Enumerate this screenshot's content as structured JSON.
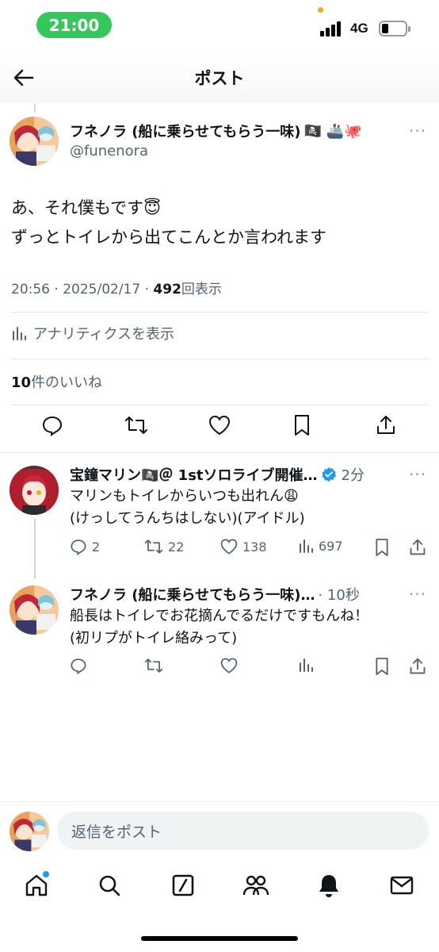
{
  "status": {
    "time": "21:00",
    "network": "4G"
  },
  "header": {
    "title": "ポスト"
  },
  "main_post": {
    "display_name": "フネノラ (船に乗らせてもらう一味)",
    "name_emoji": "🏴‍☠️ 🚢🐙",
    "handle": "@funenora",
    "text_line1": "あ、それ僕もです😇",
    "text_line2": "ずっとトイレから出てこんとか言われます",
    "timestamp": "20:56 · 2025/02/17 · ",
    "views": "492",
    "views_label": "回表示",
    "analytics_label": "アナリティクスを表示",
    "likes_count": "10",
    "likes_label": "件のいいね"
  },
  "replies": [
    {
      "display_name": "宝鐘マリン🏴‍☠️＠ 1stソロライブ開催…",
      "time": "2分",
      "text_line1": "マリンもトイレからいつも出れん😩",
      "text_line2": "(けっしてうんちはしない)(アイドル)",
      "reply_count": "2",
      "retweet_count": "22",
      "like_count": "138",
      "view_count": "697"
    },
    {
      "display_name": "フネノラ (船に乗らせてもらう一味)…",
      "time": "· 10秒",
      "text_line1": "船長はトイレでお花摘んでるだけですもんね！",
      "text_line2": "(初リプがトイレ絡みって)"
    }
  ],
  "composer": {
    "placeholder": "返信をポスト"
  },
  "colors": {
    "accent": "#1d9bf0",
    "status_green": "#34c759",
    "text_secondary": "#536471"
  }
}
